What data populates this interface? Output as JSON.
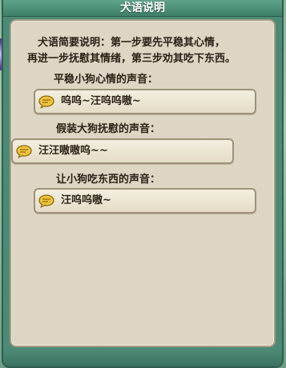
{
  "window": {
    "title": "犬语说明"
  },
  "intro": {
    "line1": "犬语简要说明：第一步要先平稳其心情，",
    "line2": "再进一步抚慰其情绪，第三步劝其吃下东西。"
  },
  "sections": [
    {
      "label": "平稳小狗心情的声音：",
      "option": "呜呜~汪呜呜嗷~"
    },
    {
      "label": "假装大狗抚慰的声音：",
      "option": "汪汪嗷嗷呜~~"
    },
    {
      "label": "让小狗吃东西的声音：",
      "option": "汪呜呜嗷~"
    }
  ],
  "icons": {
    "option_icon": "speech-bubble-icon"
  },
  "colors": {
    "panel_bg": "#ddd6c4",
    "frame": "#4d8a76",
    "text": "#2b2217",
    "bubble": "#f2c23a"
  }
}
